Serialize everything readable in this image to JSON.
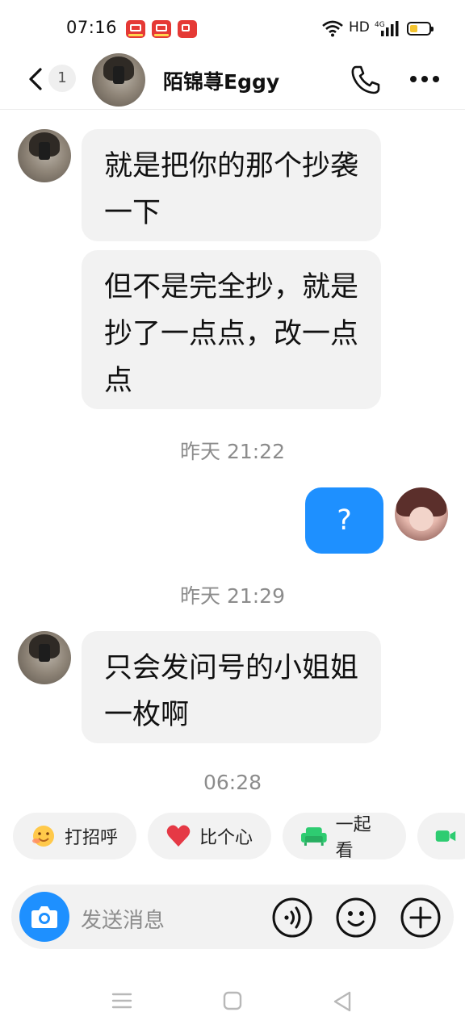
{
  "status_bar": {
    "time": "07:16",
    "network": "HD",
    "network_type": "4G",
    "battery_level": 0.3,
    "notification_icons": [
      "app-notification-icon",
      "app-notification-icon",
      "video-notification-icon"
    ]
  },
  "header": {
    "unread_count": "1",
    "contact_name": "陌锦荨Eggy"
  },
  "messages": [
    {
      "side": "in",
      "text": "就是把你的那个抄袭一下"
    },
    {
      "side": "in",
      "text": "但不是完全抄，就是抄了一点点，改一点点"
    },
    {
      "type": "time",
      "text": "昨天 21:22"
    },
    {
      "side": "out",
      "text": "?"
    },
    {
      "type": "time",
      "text": "昨天 21:29"
    },
    {
      "side": "in",
      "text": "只会发问号的小姐姐一枚啊"
    },
    {
      "type": "time",
      "text": "06:28"
    }
  ],
  "quick_actions": [
    {
      "label": "打招呼",
      "icon": "waving-emoji-icon"
    },
    {
      "label": "比个心",
      "icon": "heart-icon"
    },
    {
      "label": "一起看",
      "icon": "sofa-icon"
    },
    {
      "label": "",
      "icon": "video-call-icon"
    }
  ],
  "input": {
    "placeholder": "发送消息"
  },
  "colors": {
    "accent": "#1e90ff",
    "bubble_in": "#f2f2f2",
    "timestamp": "#8c8c8c",
    "badge_red": "#e53935",
    "sofa_green": "#2ecc71",
    "heart_red": "#e53945"
  }
}
